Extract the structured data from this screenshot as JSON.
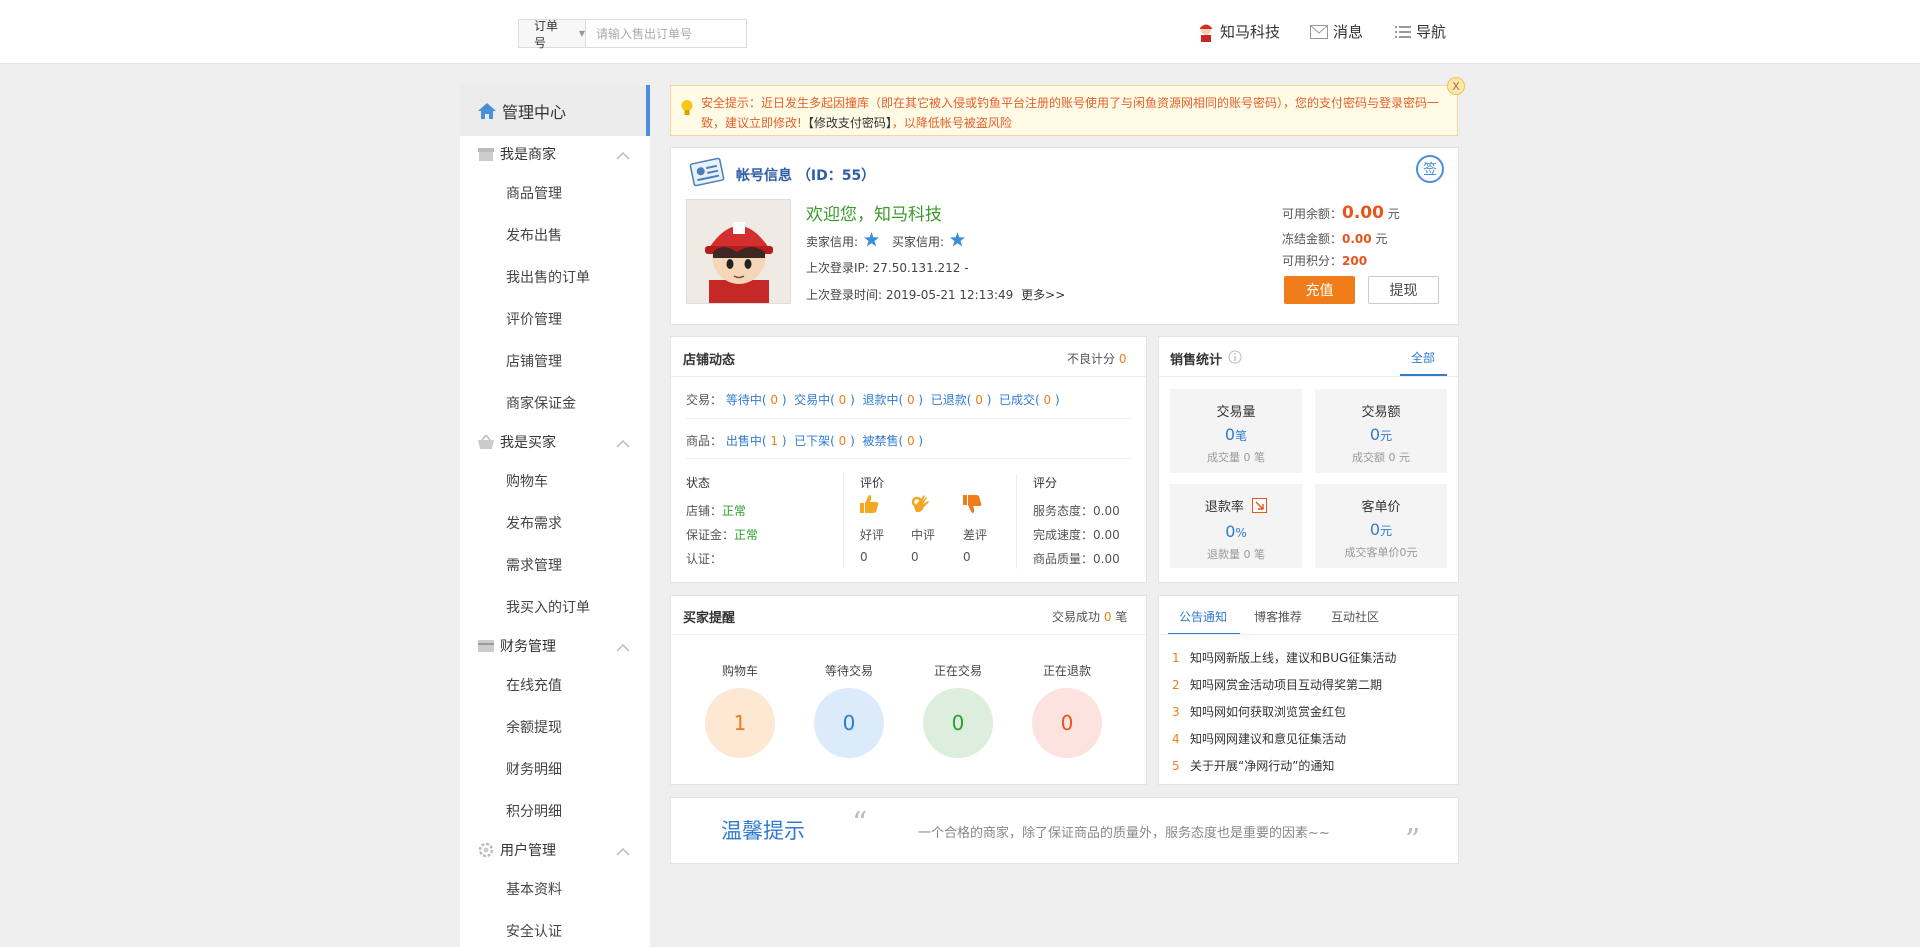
{
  "search": {
    "type_label": "订单号",
    "placeholder": "请输入售出订单号"
  },
  "top_nav": {
    "user": "知马科技",
    "messages": "消息",
    "navigation": "导航"
  },
  "sidebar": {
    "header": "管理中心",
    "groups": [
      {
        "label": "我是商家",
        "items": [
          "商品管理",
          "发布出售",
          "我出售的订单",
          "评价管理",
          "店铺管理",
          "商家保证金"
        ]
      },
      {
        "label": "我是买家",
        "items": [
          "购物车",
          "发布需求",
          "需求管理",
          "我买入的订单"
        ]
      },
      {
        "label": "财务管理",
        "items": [
          "在线充值",
          "余额提现",
          "财务明细",
          "积分明细"
        ]
      },
      {
        "label": "用户管理",
        "items": [
          "基本资料",
          "安全认证"
        ]
      }
    ]
  },
  "alert": {
    "text_before": "安全提示：近日发生多起因撞库（即在其它被入侵或钓鱼平台注册的账号使用了与闲鱼资源网相同的账号密码），您的支付密码与登录密码一致，建议立即修改!",
    "link": "【修改支付密码】",
    "text_after": "，以降低帐号被盗风险",
    "close": "X"
  },
  "account": {
    "title": "帐号信息 （ID：55）",
    "sign_badge": "签",
    "welcome": "欢迎您，知马科技",
    "seller_credit": "卖家信用:",
    "buyer_credit": "买家信用:",
    "last_ip": "上次登录IP: 27.50.131.212 -",
    "last_time": "上次登录时间: 2019-05-21 12:13:49",
    "more": "更多>>",
    "balance_label": "可用余额：",
    "balance": "0.00",
    "frozen_label": "冻结金额：",
    "frozen": "0.00",
    "points_label": "可用积分：",
    "points": "200",
    "unit_yuan": "元",
    "recharge": "充值",
    "withdraw": "提现"
  },
  "shop": {
    "title": "店铺动态",
    "bad_score_label": "不良计分",
    "bad_score": "0",
    "trade_label": "交易：",
    "trade_items": [
      {
        "label": "等待中",
        "count": "0"
      },
      {
        "label": "交易中",
        "count": "0"
      },
      {
        "label": "退款中",
        "count": "0"
      },
      {
        "label": "已退款",
        "count": "0"
      },
      {
        "label": "已成交",
        "count": "0"
      }
    ],
    "goods_label": "商品：",
    "goods_items": [
      {
        "label": "出售中",
        "count": "1"
      },
      {
        "label": "已下架",
        "count": "0"
      },
      {
        "label": "被禁售",
        "count": "0"
      }
    ],
    "status": {
      "title": "状态",
      "shop_label": "店铺：",
      "shop_value": "正常",
      "deposit_label": "保证金：",
      "deposit_value": "正常",
      "auth_label": "认证："
    },
    "review": {
      "title": "评价",
      "good": "好评",
      "neutral": "中评",
      "bad": "差评",
      "good_count": "0",
      "neutral_count": "0",
      "bad_count": "0"
    },
    "score": {
      "title": "评分",
      "service": "服务态度：0.00",
      "speed": "完成速度：0.00",
      "quality": "商品质量：0.00"
    }
  },
  "sales": {
    "title": "销售统计",
    "tab_all": "全部",
    "boxes": [
      {
        "label": "交易量",
        "value": "0",
        "unit": "笔",
        "sub": "成交量 0 笔"
      },
      {
        "label": "交易额",
        "value": "0",
        "unit": "元",
        "sub": "成交额 0 元"
      },
      {
        "label": "退款率",
        "value": "0",
        "unit": "%",
        "sub": "退款量 0 笔"
      },
      {
        "label": "客单价",
        "value": "0",
        "unit": "元",
        "sub": "成交客单价0元"
      }
    ]
  },
  "buyer": {
    "title": "买家提醒",
    "success_label": "交易成功",
    "success_count": "0",
    "success_unit": "笔",
    "circles": [
      {
        "label": "购物车",
        "value": "1",
        "color": "#fde8d3",
        "text_color": "#f07d1a"
      },
      {
        "label": "等待交易",
        "value": "0",
        "color": "#dcebfa",
        "text_color": "#2f7bd2"
      },
      {
        "label": "正在交易",
        "value": "0",
        "color": "#dceedd",
        "text_color": "#2e9e2e"
      },
      {
        "label": "正在退款",
        "value": "0",
        "color": "#fde3df",
        "text_color": "#e8541c"
      }
    ]
  },
  "notices": {
    "tabs": [
      "公告通知",
      "博客推荐",
      "互动社区"
    ],
    "items": [
      {
        "n": "1",
        "text": "知吗网新版上线，建议和BUG征集活动"
      },
      {
        "n": "2",
        "text": "知吗网赏金活动项目互动得奖第二期"
      },
      {
        "n": "3",
        "text": "知吗网如何获取浏览赏金红包"
      },
      {
        "n": "4",
        "text": "知吗网网建议和意见征集活动"
      },
      {
        "n": "5",
        "text": "关于开展“净网行动”的通知"
      }
    ]
  },
  "tip": {
    "title": "温馨提示",
    "text": "一个合格的商家，除了保证商品的质量外，服务态度也是重要的因素~~",
    "open_quote": "“",
    "close_quote": "”"
  },
  "colors": {
    "accent": "#2f7bd2",
    "orange": "#f07d1a",
    "green": "#2e9e2e"
  },
  "icons": [
    "home-icon",
    "shop-icon",
    "basket-icon",
    "card-icon",
    "gear-icon",
    "chevron-up-icon",
    "bulb-icon",
    "id-card-icon",
    "avatar",
    "star-icon",
    "thumb-up-icon",
    "ok-hand-icon",
    "thumb-down-icon",
    "info-icon",
    "refund-icon",
    "mail-icon",
    "list-icon"
  ]
}
